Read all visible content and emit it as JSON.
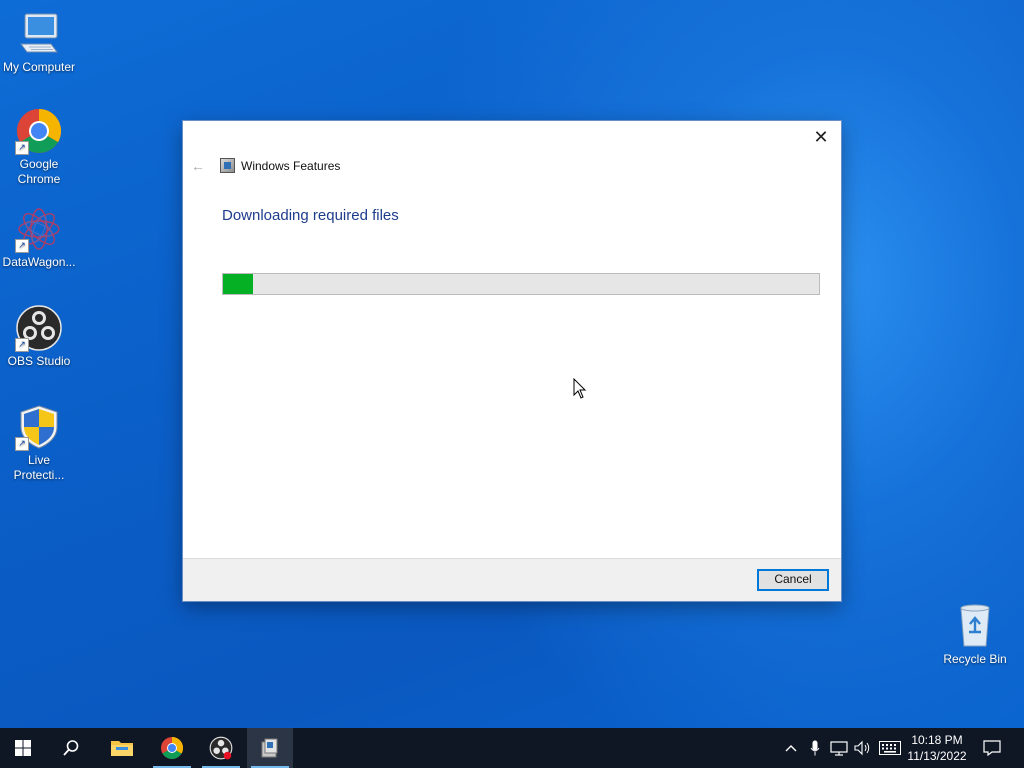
{
  "desktop": {
    "icons": [
      {
        "label": "My Computer"
      },
      {
        "label": "Google Chrome"
      },
      {
        "label": "DataWagon..."
      },
      {
        "label": "OBS Studio"
      },
      {
        "label": "Live Protecti..."
      },
      {
        "label": "Recycle Bin"
      }
    ]
  },
  "dialog": {
    "title": "Windows Features",
    "heading": "Downloading required files",
    "progress": 0.05,
    "cancel_label": "Cancel",
    "close_glyph": "✕",
    "back_glyph": "←"
  },
  "taskbar": {
    "time": "10:18 PM",
    "date": "11/13/2022",
    "items": [
      "start-icon",
      "search-icon",
      "file-explorer-icon",
      "chrome-icon",
      "obs-studio-icon",
      "windows-features-icon"
    ]
  },
  "colors": {
    "accent": "#0078d7",
    "progress_fill": "#06b025",
    "heading": "#1e3c8c",
    "taskbar": "#0f1624"
  }
}
